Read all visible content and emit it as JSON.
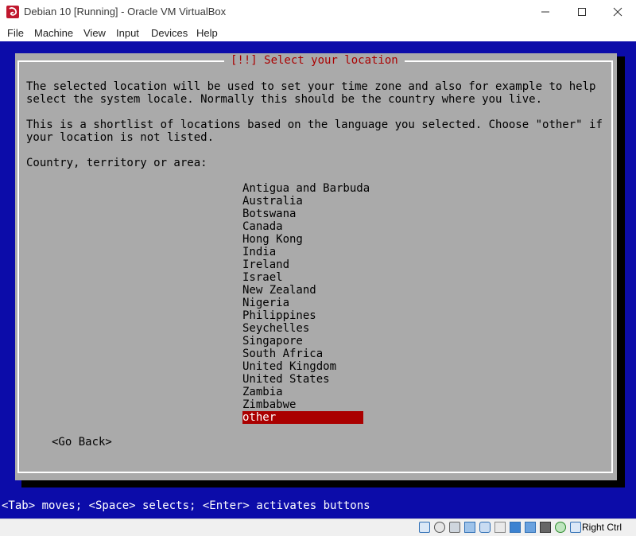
{
  "window": {
    "title": "Debian 10 [Running] - Oracle VM VirtualBox",
    "icon": "virtualbox-icon"
  },
  "menu": [
    "File",
    "Machine",
    "View",
    "Input",
    "Devices",
    "Help"
  ],
  "dialog": {
    "title": "[!!] Select your location",
    "para1_line1": "The selected location will be used to set your time zone and also for example to help",
    "para1_line2": "select the system locale. Normally this should be the country where you live.",
    "para2_line1": "This is a shortlist of locations based on the language you selected. Choose \"other\" if",
    "para2_line2": "your location is not listed.",
    "prompt": "Country, territory or area:",
    "locations": [
      "Antigua and Barbuda",
      "Australia",
      "Botswana",
      "Canada",
      "Hong Kong",
      "India",
      "Ireland",
      "Israel",
      "New Zealand",
      "Nigeria",
      "Philippines",
      "Seychelles",
      "Singapore",
      "South Africa",
      "United Kingdom",
      "United States",
      "Zambia",
      "Zimbabwe",
      "other"
    ],
    "selected": "other",
    "go_back": "<Go Back>"
  },
  "helpline": "<Tab> moves; <Space> selects; <Enter> activates buttons",
  "statusbar": {
    "icons": [
      "hard-disk-icon",
      "optical-drive-icon",
      "audio-icon",
      "network-icon",
      "usb-icon",
      "shared-folder-icon",
      "display-icon",
      "video-capture-icon",
      "cpu-icon",
      "mouse-integration-icon",
      "keyboard-icon"
    ],
    "host_key": "Right Ctrl"
  },
  "colors": {
    "console_blue": "#0c0ca9",
    "dialog_gray": "#aaaaaa",
    "highlight_red": "#aa0000"
  }
}
